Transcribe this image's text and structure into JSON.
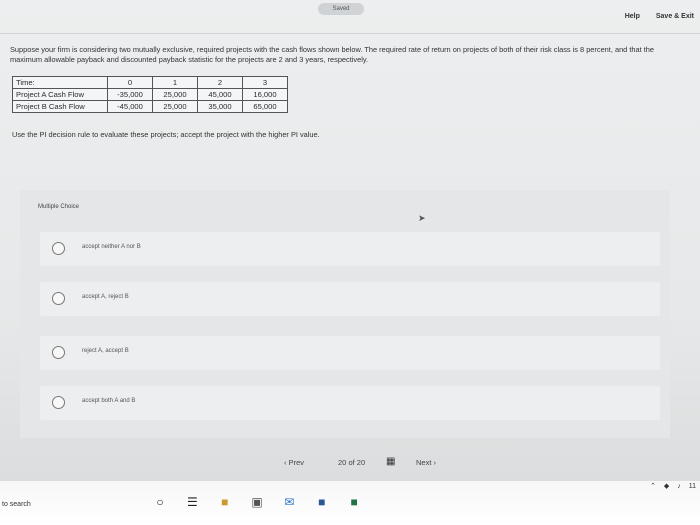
{
  "header": {
    "status": "Saved",
    "help_label": "Help",
    "save_exit_label": "Save & Exit"
  },
  "question": {
    "prompt": "Suppose your firm is considering two mutually exclusive, required projects with the cash flows shown below. The required rate of return on projects of both of their risk class is 8 percent, and that the maximum allowable payback and discounted payback statistic for the projects are 2 and 3 years, respectively.",
    "instruction": "Use the PI decision rule to evaluate these projects; accept the project with the higher PI value."
  },
  "cash_flow_table": {
    "rows": [
      [
        "Time:",
        "0",
        "1",
        "2",
        "3"
      ],
      [
        "Project A Cash Flow",
        "-35,000",
        "25,000",
        "45,000",
        "16,000"
      ],
      [
        "Project B Cash Flow",
        "-45,000",
        "25,000",
        "35,000",
        "65,000"
      ]
    ]
  },
  "multiple_choice": {
    "label": "Multiple Choice",
    "options": [
      "accept neither A nor B",
      "accept A, reject B",
      "reject A, accept B",
      "accept both A and B"
    ]
  },
  "navigation": {
    "prev_label": "Prev",
    "page_current": "20",
    "page_of": "of",
    "page_total": "20",
    "next_label": "Next"
  },
  "taskbar": {
    "search_text": "to search",
    "icons": [
      "cortana-circle-icon",
      "task-view-icon",
      "file-explorer-icon",
      "store-icon",
      "mail-icon",
      "word-icon",
      "excel-icon"
    ],
    "tray_time": "11"
  }
}
